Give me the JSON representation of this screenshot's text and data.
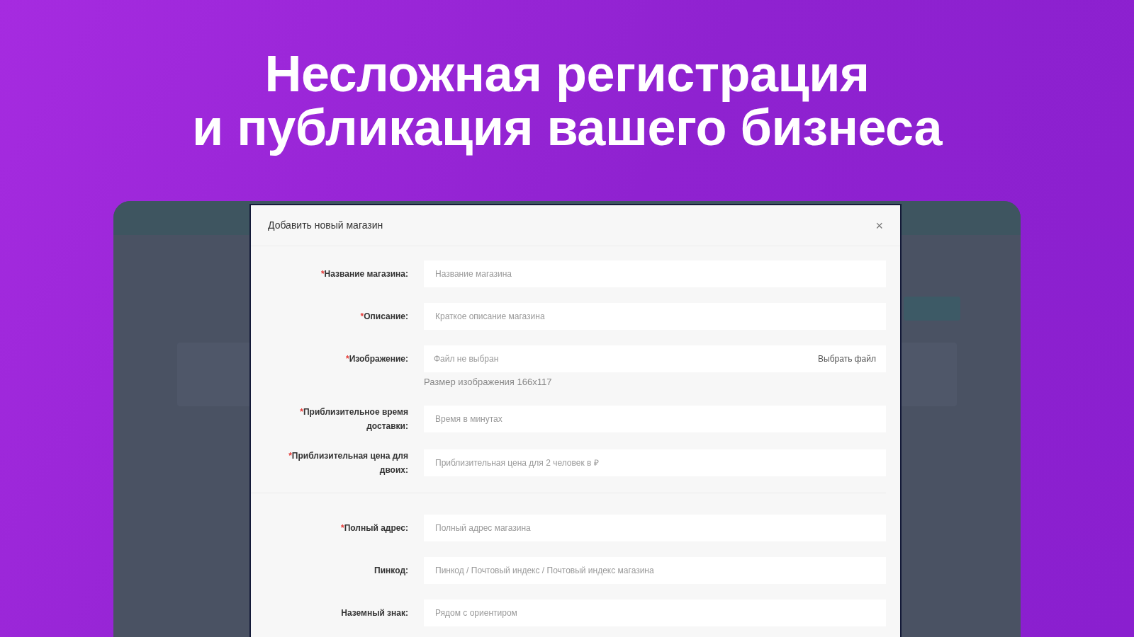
{
  "headline": [
    "Несложная регистрация",
    "и публикация вашего бизнеса"
  ],
  "modal": {
    "title": "Добавить новый магазин",
    "close": "×",
    "fields": [
      {
        "kind": "text",
        "required_mark": "*",
        "separator_before": false,
        "label": "Название магазина:",
        "placeholder": "Название магазина"
      },
      {
        "kind": "text",
        "required_mark": "*",
        "separator_before": false,
        "label": "Описание:",
        "placeholder": "Краткое описание магазина"
      },
      {
        "kind": "file",
        "required_mark": "*",
        "separator_before": false,
        "label": "Изображение:",
        "placeholder": "Файл не выбран",
        "button": "Выбрать файл",
        "hint": "Размер изображения 166x117"
      },
      {
        "kind": "text",
        "required_mark": "*",
        "separator_before": false,
        "label": "Приблизительное время доставки:",
        "placeholder": "Время в минутах"
      },
      {
        "kind": "text",
        "required_mark": "*",
        "separator_before": false,
        "label": "Приблизительная цена для двоих:",
        "placeholder": "Приблизительная цена для 2 человек в ₽"
      },
      {
        "kind": "text",
        "required_mark": "*",
        "separator_before": true,
        "label": "Полный адрес:",
        "placeholder": "Полный адрес магазина"
      },
      {
        "kind": "text",
        "separator_before": false,
        "label": "Пинкод:",
        "placeholder": "Пинкод / Почтовый индекс / Почтовый индекс магазина"
      },
      {
        "kind": "text",
        "separator_before": false,
        "label": "Наземный знак:",
        "placeholder": "Рядом с ориентиром"
      }
    ]
  }
}
